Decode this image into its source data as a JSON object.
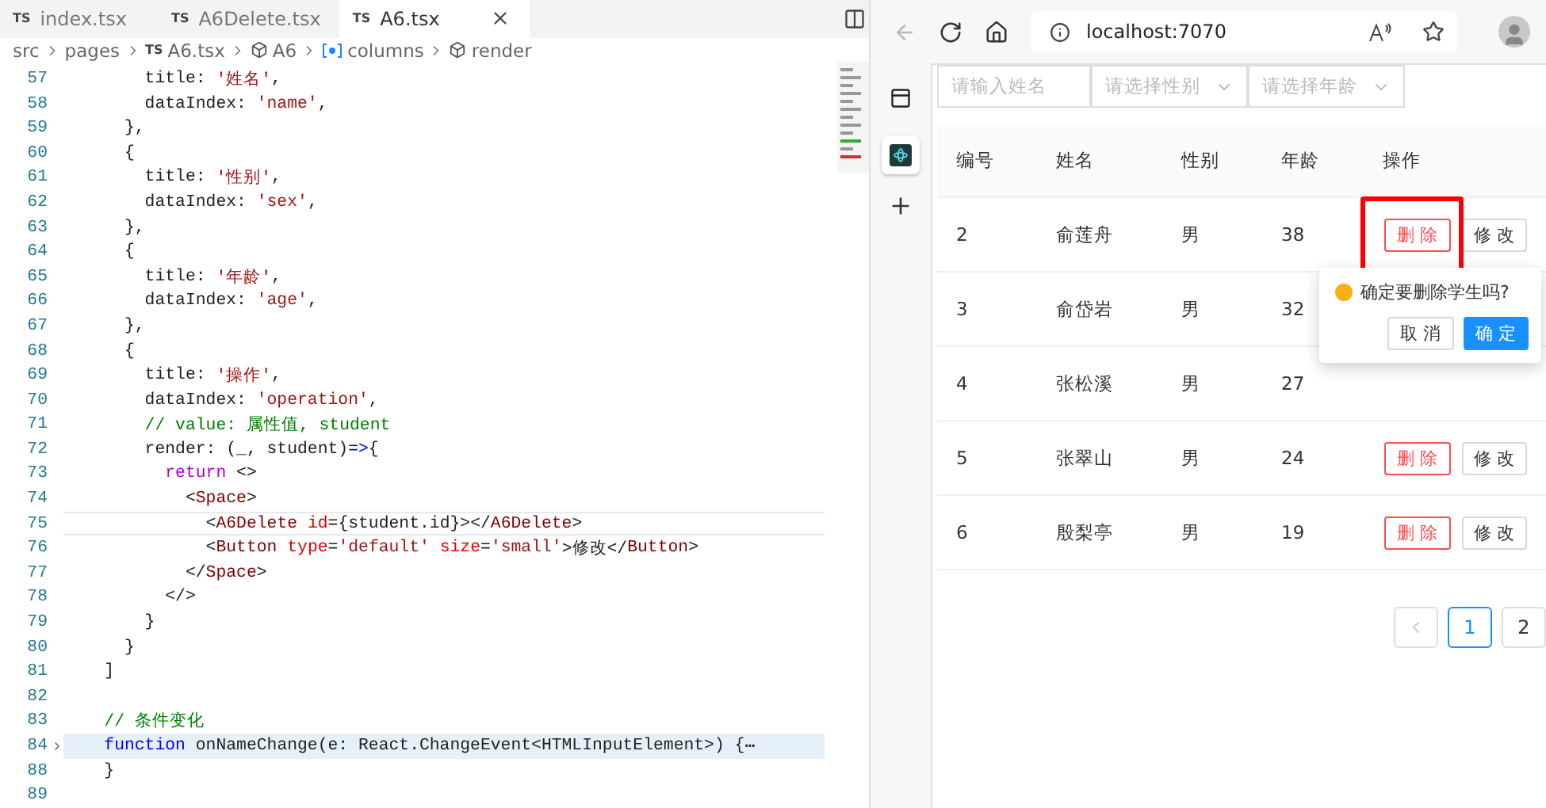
{
  "editor": {
    "tabs": [
      {
        "badge": "TS",
        "label": "index.tsx",
        "selected": false
      },
      {
        "badge": "TS",
        "label": "A6Delete.tsx",
        "selected": false
      },
      {
        "badge": "TS",
        "label": "A6.tsx",
        "selected": true
      }
    ],
    "breadcrumb": [
      {
        "label": "src",
        "kind": "folder"
      },
      {
        "label": "pages",
        "kind": "folder"
      },
      {
        "label": "A6.tsx",
        "kind": "file",
        "badge": "TS"
      },
      {
        "label": "A6",
        "kind": "component"
      },
      {
        "label": "columns",
        "kind": "variable"
      },
      {
        "label": "render",
        "kind": "component"
      }
    ],
    "lines": [
      {
        "number": "57",
        "current": false,
        "folded": false,
        "tokens": [
          {
            "text": "        title: ",
            "kind": "p"
          },
          {
            "text": "'姓名'",
            "kind": "s"
          },
          {
            "text": ",",
            "kind": "p"
          }
        ]
      },
      {
        "number": "58",
        "current": false,
        "folded": false,
        "tokens": [
          {
            "text": "        dataIndex: ",
            "kind": "p"
          },
          {
            "text": "'name'",
            "kind": "s"
          },
          {
            "text": ",",
            "kind": "p"
          }
        ]
      },
      {
        "number": "59",
        "current": false,
        "folded": false,
        "tokens": [
          {
            "text": "      },",
            "kind": "p"
          }
        ]
      },
      {
        "number": "60",
        "current": false,
        "folded": false,
        "tokens": [
          {
            "text": "      {",
            "kind": "p"
          }
        ]
      },
      {
        "number": "61",
        "current": false,
        "folded": false,
        "tokens": [
          {
            "text": "        title: ",
            "kind": "p"
          },
          {
            "text": "'性别'",
            "kind": "s"
          },
          {
            "text": ",",
            "kind": "p"
          }
        ]
      },
      {
        "number": "62",
        "current": false,
        "folded": false,
        "tokens": [
          {
            "text": "        dataIndex: ",
            "kind": "p"
          },
          {
            "text": "'sex'",
            "kind": "s"
          },
          {
            "text": ",",
            "kind": "p"
          }
        ]
      },
      {
        "number": "63",
        "current": false,
        "folded": false,
        "tokens": [
          {
            "text": "      },",
            "kind": "p"
          }
        ]
      },
      {
        "number": "64",
        "current": false,
        "folded": false,
        "tokens": [
          {
            "text": "      {",
            "kind": "p"
          }
        ]
      },
      {
        "number": "65",
        "current": false,
        "folded": false,
        "tokens": [
          {
            "text": "        title: ",
            "kind": "p"
          },
          {
            "text": "'年龄'",
            "kind": "s"
          },
          {
            "text": ",",
            "kind": "p"
          }
        ]
      },
      {
        "number": "66",
        "current": false,
        "folded": false,
        "tokens": [
          {
            "text": "        dataIndex: ",
            "kind": "p"
          },
          {
            "text": "'age'",
            "kind": "s"
          },
          {
            "text": ",",
            "kind": "p"
          }
        ]
      },
      {
        "number": "67",
        "current": false,
        "folded": false,
        "tokens": [
          {
            "text": "      },",
            "kind": "p"
          }
        ]
      },
      {
        "number": "68",
        "current": false,
        "folded": false,
        "tokens": [
          {
            "text": "      {",
            "kind": "p"
          }
        ]
      },
      {
        "number": "69",
        "current": false,
        "folded": false,
        "tokens": [
          {
            "text": "        title: ",
            "kind": "p"
          },
          {
            "text": "'操作'",
            "kind": "s"
          },
          {
            "text": ",",
            "kind": "p"
          }
        ]
      },
      {
        "number": "70",
        "current": false,
        "folded": false,
        "tokens": [
          {
            "text": "        dataIndex: ",
            "kind": "p"
          },
          {
            "text": "'operation'",
            "kind": "s"
          },
          {
            "text": ",",
            "kind": "p"
          }
        ]
      },
      {
        "number": "71",
        "current": false,
        "folded": false,
        "tokens": [
          {
            "text": "        // value: 属性值, student",
            "kind": "c"
          }
        ]
      },
      {
        "number": "72",
        "current": false,
        "folded": false,
        "tokens": [
          {
            "text": "        render: (_, student)",
            "kind": "p"
          },
          {
            "text": "=>",
            "kind": "k"
          },
          {
            "text": "{",
            "kind": "p"
          }
        ]
      },
      {
        "number": "73",
        "current": false,
        "folded": false,
        "tokens": [
          {
            "text": "          return",
            "kind": "r"
          },
          {
            "text": " <>",
            "kind": "p"
          }
        ]
      },
      {
        "number": "74",
        "current": false,
        "folded": false,
        "tokens": [
          {
            "text": "            <",
            "kind": "p"
          },
          {
            "text": "Space",
            "kind": "t"
          },
          {
            "text": ">",
            "kind": "p"
          }
        ]
      },
      {
        "number": "75",
        "current": true,
        "folded": false,
        "tokens": [
          {
            "text": "              <",
            "kind": "p"
          },
          {
            "text": "A6Delete",
            "kind": "t"
          },
          {
            "text": " id",
            "kind": "a"
          },
          {
            "text": "={student.id}></",
            "kind": "p"
          },
          {
            "text": "A6Delete",
            "kind": "t"
          },
          {
            "text": ">",
            "kind": "p"
          }
        ]
      },
      {
        "number": "76",
        "current": false,
        "folded": false,
        "tokens": [
          {
            "text": "              <",
            "kind": "p"
          },
          {
            "text": "Button",
            "kind": "t"
          },
          {
            "text": " type",
            "kind": "a"
          },
          {
            "text": "=",
            "kind": "p"
          },
          {
            "text": "'default'",
            "kind": "s"
          },
          {
            "text": " size",
            "kind": "a"
          },
          {
            "text": "=",
            "kind": "p"
          },
          {
            "text": "'small'",
            "kind": "s"
          },
          {
            "text": ">修改</",
            "kind": "p"
          },
          {
            "text": "Button",
            "kind": "t"
          },
          {
            "text": ">",
            "kind": "p"
          }
        ]
      },
      {
        "number": "77",
        "current": false,
        "folded": false,
        "tokens": [
          {
            "text": "            </",
            "kind": "p"
          },
          {
            "text": "Space",
            "kind": "t"
          },
          {
            "text": ">",
            "kind": "p"
          }
        ]
      },
      {
        "number": "78",
        "current": false,
        "folded": false,
        "tokens": [
          {
            "text": "          </>",
            "kind": "p"
          }
        ]
      },
      {
        "number": "79",
        "current": false,
        "folded": false,
        "tokens": [
          {
            "text": "        }",
            "kind": "p"
          }
        ]
      },
      {
        "number": "80",
        "current": false,
        "folded": false,
        "tokens": [
          {
            "text": "      }",
            "kind": "p"
          }
        ]
      },
      {
        "number": "81",
        "current": false,
        "folded": false,
        "tokens": [
          {
            "text": "    ]",
            "kind": "p"
          }
        ]
      },
      {
        "number": "82",
        "current": false,
        "folded": false
      },
      {
        "number": "83",
        "current": false,
        "folded": false,
        "tokens": [
          {
            "text": "    // 条件变化",
            "kind": "c"
          }
        ]
      },
      {
        "number": "84",
        "current": false,
        "folded": true,
        "tokens": [
          {
            "text": "    function",
            "kind": "k"
          },
          {
            "text": " onNameChange(e: React.ChangeEvent<HTMLInputElement>) {",
            "kind": "p"
          },
          {
            "text": "⋯",
            "kind": "p"
          }
        ]
      },
      {
        "number": "88",
        "current": false,
        "folded": false,
        "tokens": [
          {
            "text": "    }",
            "kind": "p"
          }
        ]
      },
      {
        "number": "89",
        "current": false,
        "folded": false
      }
    ]
  },
  "browser": {
    "address": "localhost:7070",
    "filters": [
      {
        "kind": "input",
        "placeholder": "请输入姓名"
      },
      {
        "kind": "select",
        "placeholder": "请选择性别"
      },
      {
        "kind": "select",
        "placeholder": "请选择年龄"
      }
    ],
    "table": {
      "columns": [
        "编号",
        "姓名",
        "性别",
        "年龄",
        "操作"
      ],
      "rows": [
        {
          "cells": [
            "2",
            "俞莲舟",
            "男",
            "38"
          ],
          "actions": [
            {
              "label": "删 除",
              "kind": "danger",
              "annotated": true
            },
            {
              "label": "修 改",
              "kind": "default",
              "annotated": false
            }
          ]
        },
        {
          "cells": [
            "3",
            "俞岱岩",
            "男",
            "32"
          ]
        },
        {
          "cells": [
            "4",
            "张松溪",
            "男",
            "27"
          ]
        },
        {
          "cells": [
            "5",
            "张翠山",
            "男",
            "24"
          ],
          "actions": [
            {
              "label": "删 除",
              "kind": "danger",
              "annotated": false
            },
            {
              "label": "修 改",
              "kind": "default",
              "annotated": false
            }
          ]
        },
        {
          "cells": [
            "6",
            "殷梨亭",
            "男",
            "19"
          ],
          "actions": [
            {
              "label": "删 除",
              "kind": "danger",
              "annotated": false
            },
            {
              "label": "修 改",
              "kind": "default",
              "annotated": false
            }
          ]
        }
      ]
    },
    "popconfirm": {
      "message": "确定要删除学生吗?",
      "buttons": [
        {
          "label": "取 消",
          "primary": false
        },
        {
          "label": "确 定",
          "primary": true
        }
      ]
    },
    "pagination": [
      {
        "label": "1",
        "selected": true
      },
      {
        "label": "2",
        "selected": false
      }
    ]
  }
}
